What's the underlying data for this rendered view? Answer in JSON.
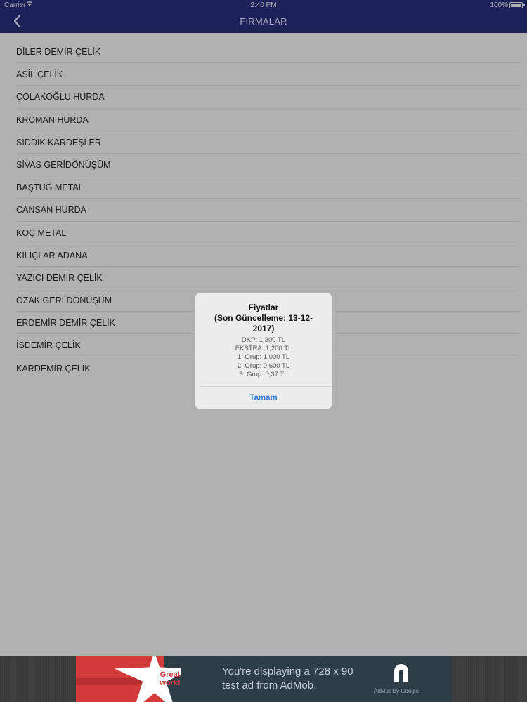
{
  "status_bar": {
    "carrier": "Carrier",
    "time": "2:40 PM",
    "battery": "100%"
  },
  "nav": {
    "title": "FIRMALAR",
    "back_icon": "chevron-left-icon"
  },
  "companies": [
    "DİLER DEMİR ÇELİK",
    "ASİL ÇELİK",
    "ÇOLAKOĞLU HURDA",
    "KROMAN HURDA",
    "SIDDIK KARDEŞLER",
    "SİVAS GERİDÖNÜŞÜM",
    "BAŞTUĞ METAL",
    "CANSAN HURDA",
    "KOÇ METAL",
    "KILIÇLAR ADANA",
    "YAZICI DEMİR ÇELİK",
    "ÖZAK GERİ DÖNÜŞÜM",
    "ERDEMİR DEMİR ÇELİK",
    "İSDEMİR ÇELİK",
    "KARDEMİR ÇELİK"
  ],
  "alert": {
    "title_lines": [
      "Fiyatlar",
      "(Son Güncelleme: 13-12-",
      "2017)"
    ],
    "message_lines": [
      "DKP: 1,300 TL",
      "EKSTRA: 1,200 TL",
      "1. Grup: 1,000 TL",
      "2. Grup: 0,600 TL",
      "3. Grup: 0,37 TL"
    ],
    "button": "Tamam"
  },
  "ad": {
    "badge_line1": "Great",
    "badge_line2": "work!",
    "text_line1": "You're displaying a 728 x 90",
    "text_line2": "test ad from AdMob.",
    "logo_caption": "AdMob by Google"
  },
  "colors": {
    "nav_bar": "#1d2159",
    "backdrop": "#b1b1b1",
    "alert_button": "#2e7ad1",
    "ad_background": "#2e3e47",
    "ad_red": "#d33a3a"
  }
}
